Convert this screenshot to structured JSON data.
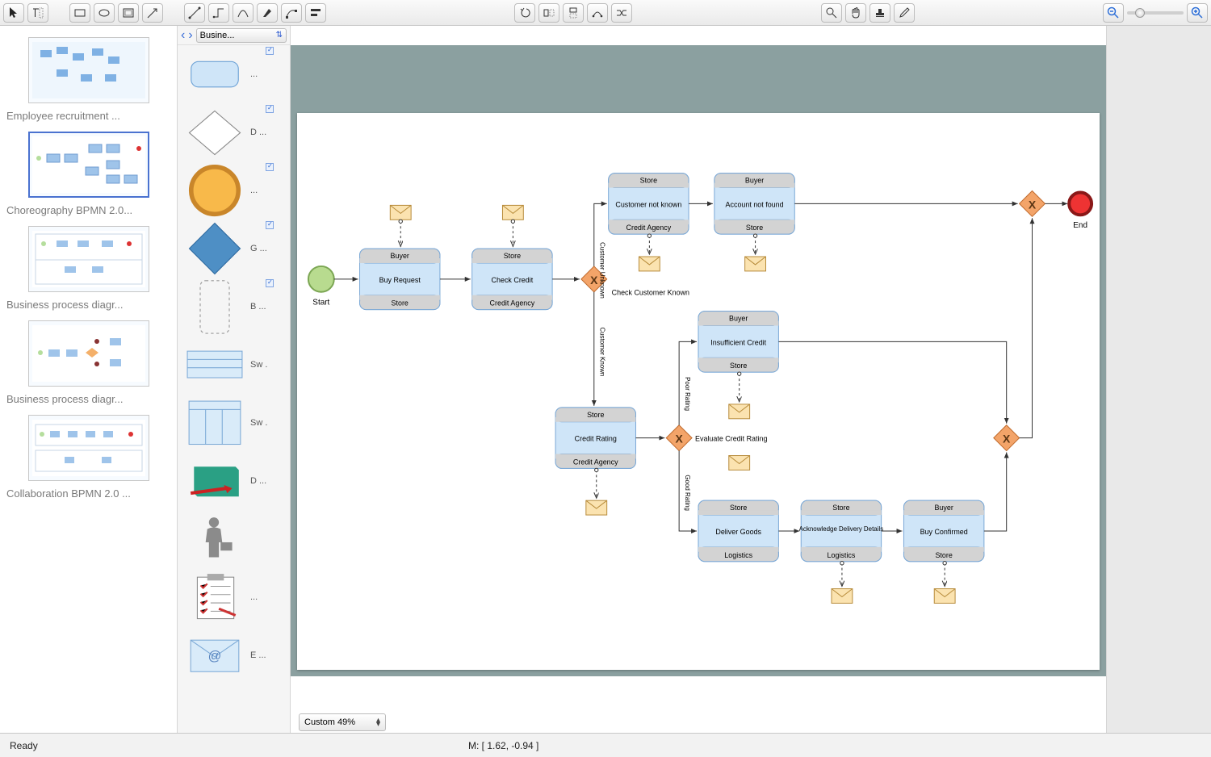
{
  "toolbar": {
    "icons": [
      "pointer",
      "text-cursor",
      "rect",
      "ellipse",
      "container",
      "arrow",
      "line",
      "connector",
      "curve",
      "pen",
      "node-edit",
      "align",
      "undo",
      "transform-h",
      "transform-v",
      "path",
      "shuffle",
      "magnifier",
      "hand",
      "stamp",
      "eyedropper",
      "zoom-out",
      "zoom-in"
    ]
  },
  "pages": {
    "items": [
      {
        "label": "Employee recruitment ..."
      },
      {
        "label": "Choreography BPMN 2.0..."
      },
      {
        "label": "Business process diagr..."
      },
      {
        "label": "Business process diagr..."
      },
      {
        "label": "Collaboration BPMN 2.0 ..."
      }
    ]
  },
  "shapes": {
    "category": "Busine...",
    "items": [
      {
        "label": "...",
        "kind": "rounded-rect",
        "tick": true
      },
      {
        "label": "D ...",
        "kind": "diamond",
        "tick": true
      },
      {
        "label": "...",
        "kind": "circle-bold",
        "tick": true
      },
      {
        "label": "G ...",
        "kind": "diamond-solid",
        "tick": true
      },
      {
        "label": "B ...",
        "kind": "dashed-rect",
        "tick": true
      },
      {
        "label": "Sw .",
        "kind": "swimlane-h",
        "tick": false
      },
      {
        "label": "Sw .",
        "kind": "swimlane-v",
        "tick": false
      },
      {
        "label": "D ...",
        "kind": "notebook",
        "tick": false
      },
      {
        "label": "",
        "kind": "person",
        "tick": false
      },
      {
        "label": "...",
        "kind": "checklist",
        "tick": false
      },
      {
        "label": "E ...",
        "kind": "mail-at",
        "tick": false
      }
    ]
  },
  "diagram": {
    "start_label": "Start",
    "end_label": "End",
    "tasks": {
      "buy_request": {
        "top": "Buyer",
        "mid": "Buy Request",
        "bot": "Store"
      },
      "check_credit": {
        "top": "Store",
        "mid": "Check Credit",
        "bot": "Credit Agency"
      },
      "customer_not_known": {
        "top": "Store",
        "mid": "Customer not known",
        "bot": "Credit Agency"
      },
      "account_not_found": {
        "top": "Buyer",
        "mid": "Account not found",
        "bot": "Store"
      },
      "credit_rating": {
        "top": "Store",
        "mid": "Credit Rating",
        "bot": "Credit Agency"
      },
      "insufficient_credit": {
        "top": "Buyer",
        "mid": "Insufficient Credit",
        "bot": "Store"
      },
      "deliver_goods": {
        "top": "Store",
        "mid": "Deliver Goods",
        "bot": "Logistics"
      },
      "ack_delivery": {
        "top": "Store",
        "mid": "Acknowledge Delivery Details",
        "bot": "Logistics"
      },
      "buy_confirmed": {
        "top": "Buyer",
        "mid": "Buy Confirmed",
        "bot": "Store"
      }
    },
    "gateway_labels": {
      "g1": "Check Customer Known",
      "g2": "Evaluate Credit Rating"
    },
    "edge_labels": {
      "unknown": "Customer Unknown",
      "known": "Customer Known",
      "poor": "Poor Rating",
      "good": "Good Rating"
    }
  },
  "zoom": {
    "label": "Custom 49%"
  },
  "status": {
    "ready": "Ready",
    "coord": "M: [ 1.62, -0.94 ]"
  }
}
